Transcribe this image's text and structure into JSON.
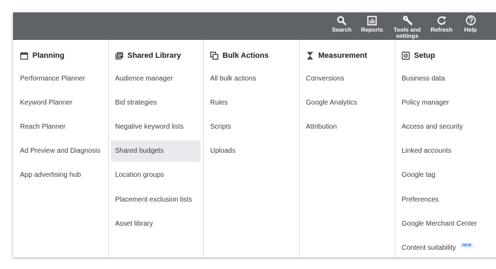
{
  "toolbar": {
    "search": "Search",
    "reports": "Reports",
    "tools_line1": "Tools and",
    "tools_line2": "settings",
    "refresh": "Refresh",
    "help": "Help"
  },
  "columns": [
    {
      "title": "Planning",
      "icon": "calendar-icon",
      "items": [
        "Performance Planner",
        "Keyword Planner",
        "Reach Planner",
        "Ad Preview and Diagnosis",
        "App advertising hub"
      ]
    },
    {
      "title": "Shared Library",
      "icon": "library-icon",
      "items": [
        "Audience manager",
        "Bid strategies",
        "Negative keyword lists",
        "Shared budgets",
        "Location groups",
        "Placement exclusion lists",
        "Asset library"
      ],
      "active": "Shared budgets"
    },
    {
      "title": "Bulk Actions",
      "icon": "copy-icon",
      "items": [
        "All bulk actions",
        "Rules",
        "Scripts",
        "Uploads"
      ]
    },
    {
      "title": "Measurement",
      "icon": "hourglass-icon",
      "items": [
        "Conversions",
        "Google Analytics",
        "Attribution"
      ]
    },
    {
      "title": "Setup",
      "icon": "setup-icon",
      "items": [
        "Business data",
        "Policy manager",
        "Access and security",
        "Linked accounts",
        "Google tag",
        "Preferences",
        "Google Merchant Center",
        "Content suitability"
      ],
      "badge": "NEW"
    }
  ]
}
